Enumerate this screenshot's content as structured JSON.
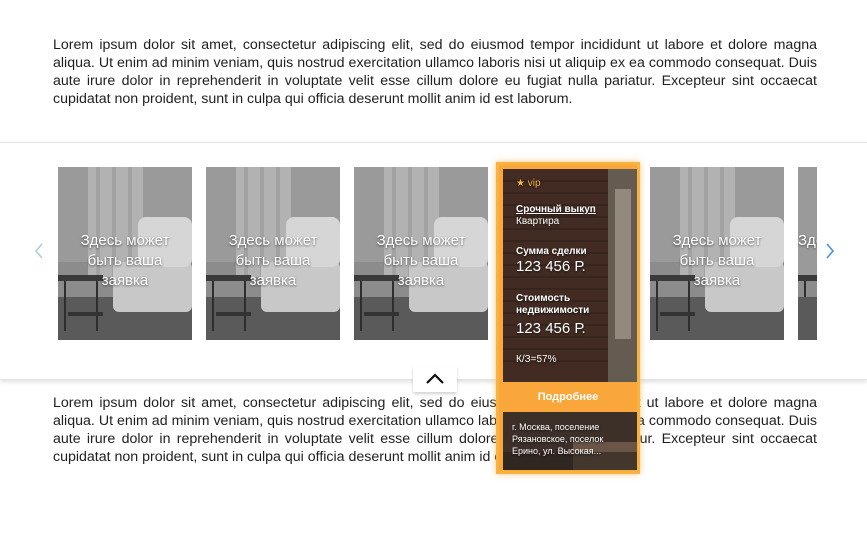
{
  "paragraphs": {
    "top": "Lorem ipsum dolor sit amet, consectetur adipiscing elit, sed do eiusmod tempor incididunt ut labore et dolore magna aliqua. Ut enim ad minim veniam, quis nostrud exercitation ullamco laboris nisi ut aliquip ex ea commodo consequat. Duis aute irure dolor in reprehenderit in voluptate velit esse cillum dolore eu fugiat nulla pariatur. Excepteur sint occaecat cupidatat non proident, sunt in culpa qui officia deserunt mollit anim id est laborum.",
    "bottom": "Lorem ipsum dolor sit amet, consectetur adipiscing elit, sed do eiusmod tempor incididunt ut labore et dolore magna aliqua. Ut enim ad minim veniam, quis nostrud exercitation ullamco laboris nisi ut aliquip ex ea commodo consequat. Duis aute irure dolor in reprehenderit in voluptate velit esse cillum dolore eu fugiat nulla pariatur. Excepteur sint occaecat cupidatat non proident, sunt in culpa qui officia deserunt mollit anim id est laborum."
  },
  "carousel": {
    "arrow_left_icon": "chevron-left-icon",
    "arrow_right_icon": "chevron-right-icon",
    "collapse_icon": "chevron-up-icon",
    "placeholder_cards": [
      {
        "text": "Здесь может быть ваша заявка"
      },
      {
        "text": "Здесь может быть ваша заявка"
      },
      {
        "text": "Здесь может быть ваша заявка"
      },
      {
        "text": "Здесь может быть ваша заявка"
      },
      {
        "text": "Здесь может"
      }
    ],
    "vip_card": {
      "badge": "★ vip",
      "title": "Срочный выкуп",
      "type": "Квартира",
      "sum_label": "Сумма сделки",
      "sum_value": "123 456 Р.",
      "cost_label": "Стоимость недвижимости",
      "cost_value": "123 456 Р.",
      "ratio": "К/З=57%",
      "more_button": "Подробнее",
      "address": "г. Москва, поселение Рязановское, поселок Ерино, ул. Высокая..."
    }
  },
  "colors": {
    "accent": "#f9a63a",
    "arrow": "#4a90e2"
  }
}
